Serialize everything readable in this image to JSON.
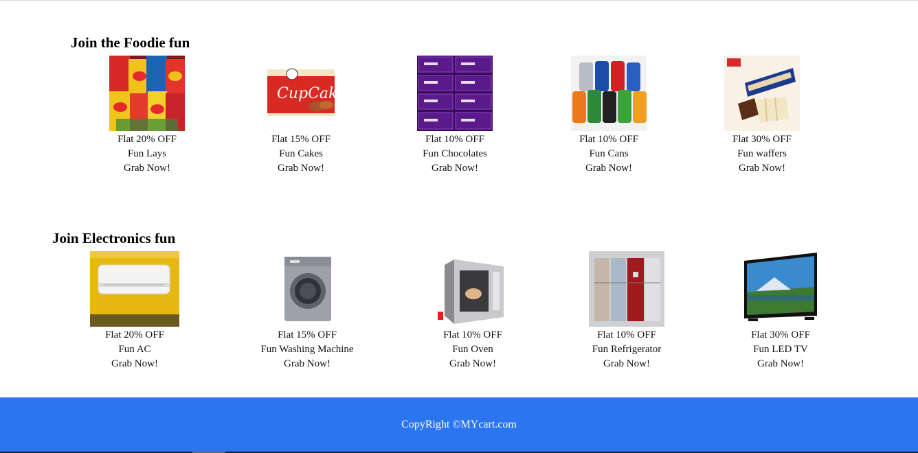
{
  "sections": [
    {
      "title": "Join the Foodie fun",
      "items": [
        {
          "offer": "Flat 20% OFF",
          "name": "Fun Lays",
          "cta": "Grab Now!",
          "image": "lays-chips-image"
        },
        {
          "offer": "Flat 15% OFF",
          "name": "Fun Cakes",
          "cta": "Grab Now!",
          "image": "cupcake-box-image"
        },
        {
          "offer": "Flat 10% OFF",
          "name": "Fun Chocolates",
          "cta": "Grab Now!",
          "image": "chocolate-bars-image"
        },
        {
          "offer": "Flat 10% OFF",
          "name": "Fun Cans",
          "cta": "Grab Now!",
          "image": "soda-cans-image"
        },
        {
          "offer": "Flat 30% OFF",
          "name": "Fun waffers",
          "cta": "Grab Now!",
          "image": "wafer-pack-image"
        }
      ]
    },
    {
      "title": "Join Electronics fun",
      "items": [
        {
          "offer": "Flat 20% OFF",
          "name": "Fun AC",
          "cta": "Grab Now!",
          "image": "air-conditioner-image"
        },
        {
          "offer": "Flat 15% OFF",
          "name": "Fun Washing Machine",
          "cta": "Grab Now!",
          "image": "washing-machine-image"
        },
        {
          "offer": "Flat 10% OFF",
          "name": "Fun Oven",
          "cta": "Grab Now!",
          "image": "microwave-oven-image"
        },
        {
          "offer": "Flat 10% OFF",
          "name": "Fun Refrigerator",
          "cta": "Grab Now!",
          "image": "refrigerator-image"
        },
        {
          "offer": "Flat 30% OFF",
          "name": "Fun LED TV",
          "cta": "Grab Now!",
          "image": "led-tv-image"
        }
      ]
    }
  ],
  "footer": {
    "copyright": "CopyRight ©MYcart.com"
  },
  "colors": {
    "footer_bg": "#2b75ee",
    "footer_text": "#ffffff"
  }
}
